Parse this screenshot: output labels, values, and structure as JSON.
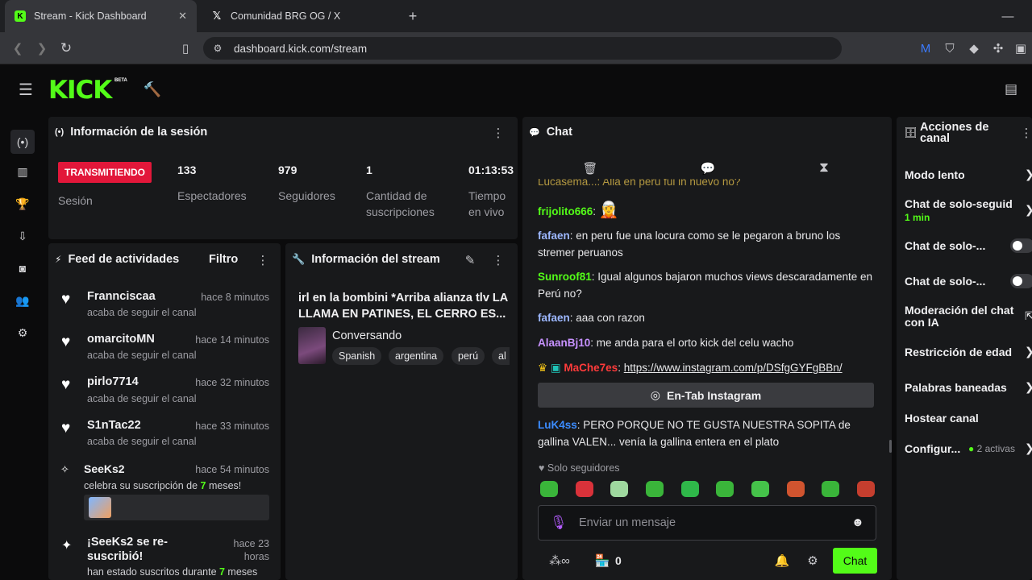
{
  "browser": {
    "tabs": [
      {
        "title": "Stream - Kick Dashboard",
        "icon": "kick-favicon"
      },
      {
        "title": "Comunidad BRG OG / X",
        "icon": "x-favicon"
      }
    ],
    "url": "dashboard.kick.com/stream"
  },
  "app": {
    "logo": "KICK",
    "beta": "BETA"
  },
  "session": {
    "title": "Información de la sesión",
    "live_badge": "TRANSMITIENDO",
    "session_label": "Sesión",
    "stats": [
      {
        "value": "133",
        "label": "Espectadores"
      },
      {
        "value": "979",
        "label": "Seguidores"
      },
      {
        "value": "1",
        "label": "Cantidad de suscripciones"
      },
      {
        "value": "01:13:53",
        "label": "Tiempo en vivo"
      }
    ]
  },
  "feed": {
    "title": "Feed de actividades",
    "filter": "Filtro",
    "items": [
      {
        "name": "Frannciscaa",
        "time": "hace 8 minutos",
        "sub": "acaba de seguir el canal"
      },
      {
        "name": "omarcitoMN",
        "time": "hace 14 minutos",
        "sub": "acaba de seguir el canal"
      },
      {
        "name": "pirlo7714",
        "time": "hace 32 minutos",
        "sub": "acaba de seguir el canal"
      },
      {
        "name": "S1nTac22",
        "time": "hace 33 minutos",
        "sub": "acaba de seguir el canal"
      }
    ],
    "sub_event": {
      "name": "SeeKs2",
      "time": "hace 54 minutos",
      "text_a": "celebra su suscripción de ",
      "months": "7",
      "text_b": " meses!"
    },
    "resub_event": {
      "title": "¡SeeKs2 se re-suscribió!",
      "time": "hace 23 horas",
      "text_a": "han estado suscritos durante ",
      "months": "7",
      "text_b": " meses"
    }
  },
  "stream_info": {
    "title": "Información del stream",
    "stream_title": "irl en la bombini *Arriba alianza tlv LA LLAMA EN PATINES, EL CERRO ES...",
    "category": "Conversando",
    "tags": [
      "Spanish",
      "argentina",
      "perú",
      "al"
    ]
  },
  "chat": {
    "title": "Chat",
    "partial_line": "Lucasema...: Allá en perú fui in nuevo no?",
    "messages": [
      {
        "user": "frijolito666",
        "color": "#53fc18",
        "text": ""
      },
      {
        "user": "fafaen",
        "color": "#9db8ff",
        "text": "en peru fue una locura como se le pegaron a bruno los stremer peruanos"
      },
      {
        "user": "Sunroof81",
        "color": "#53fc18",
        "text": "Igual algunos bajaron muchos views descaradamente en Perú no?"
      },
      {
        "user": "fafaen",
        "color": "#9db8ff",
        "text": "aaa con razon"
      },
      {
        "user": "AlaanBj10",
        "color": "#c792ff",
        "text": "me anda para el orto kick del celu wacho"
      },
      {
        "user": "MaChe7es",
        "color": "#ff3b3b",
        "text": "https://www.instagram.com/p/DSfgGYFgBBn/"
      }
    ],
    "link_button": "En-Tab Instagram",
    "last": {
      "user": "LuK4ss",
      "color": "#3b8cff",
      "text": "PERO PORQUE NO TE GUSTA NUESTRA SOPITA de gallina VALEN... venía la gallina entera en el plato"
    },
    "followers_only": "Solo seguidores",
    "input_placeholder": "Enviar un mensaje",
    "points": "0",
    "send": "Chat"
  },
  "actions": {
    "title": "Acciones de canal",
    "items": [
      {
        "label": "Modo lento"
      },
      {
        "label": "Chat de solo-seguid",
        "sub": "1 min"
      },
      {
        "label": "Chat de solo-..."
      },
      {
        "label": "Chat de solo-..."
      },
      {
        "label": "Moderación del chat con IA"
      },
      {
        "label": "Restricción de edad"
      },
      {
        "label": "Palabras baneadas"
      },
      {
        "label": "Hostear canal"
      },
      {
        "label": "Configur...",
        "sub": "2 activas"
      }
    ]
  }
}
